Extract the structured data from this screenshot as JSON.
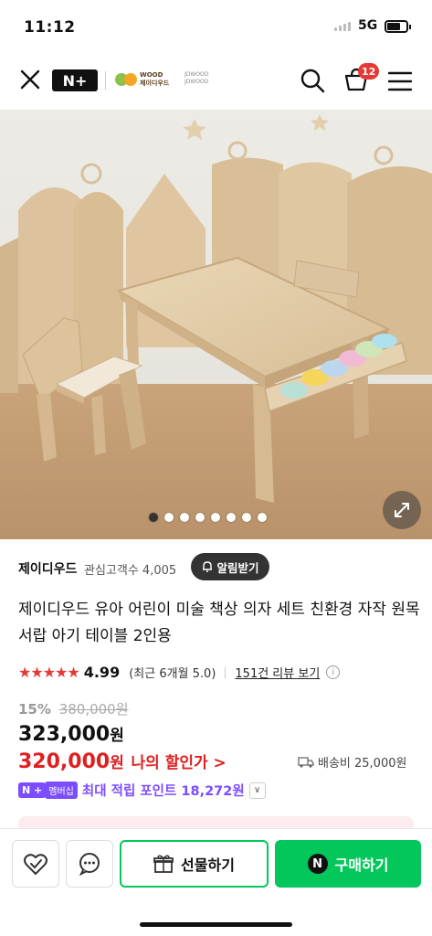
{
  "status_bar": {
    "time": "11:12",
    "network": "5G"
  },
  "nav": {
    "brand_badge": "N+",
    "store_logo_line1": "WOOD",
    "store_logo_line2": "제이디우드",
    "store_logo_alt1": "JDWOOD",
    "store_logo_alt2": "JDWOOD",
    "cart_count": "12"
  },
  "gallery": {
    "total_slides": 8,
    "active_index": 0
  },
  "store": {
    "name": "제이디우드",
    "followers": "관심고객수 4,005",
    "alert_label": "알림받기"
  },
  "product": {
    "title": "제이디우드 유아 어린이 미술 책상 의자 세트 친환경 자작 원목 서랍 아기 테이블 2인용",
    "stars": "★★★★★",
    "rating": "4.99",
    "recent": "(최근 6개월 5.0)",
    "reviews": "151건 리뷰 보기",
    "discount": "15%",
    "original_price": "380,000원",
    "price": "323,000",
    "price_unit": "원",
    "my_price": "320,000",
    "my_price_unit": "원",
    "my_discount_label": "나의 할인가 >",
    "shipping": "배송비 25,000원",
    "membership_badge": "N +",
    "membership_label": "멤버십",
    "points": "최대 적립 포인트 18,272원"
  },
  "bottom_bar": {
    "gift_label": "선물하기",
    "buy_label": "구매하기",
    "buy_badge": "N"
  },
  "colors": {
    "naver_green": "#03c75a",
    "price_red": "#e02020",
    "membership_purple": "#7c4dff",
    "star_red": "#e53935"
  }
}
